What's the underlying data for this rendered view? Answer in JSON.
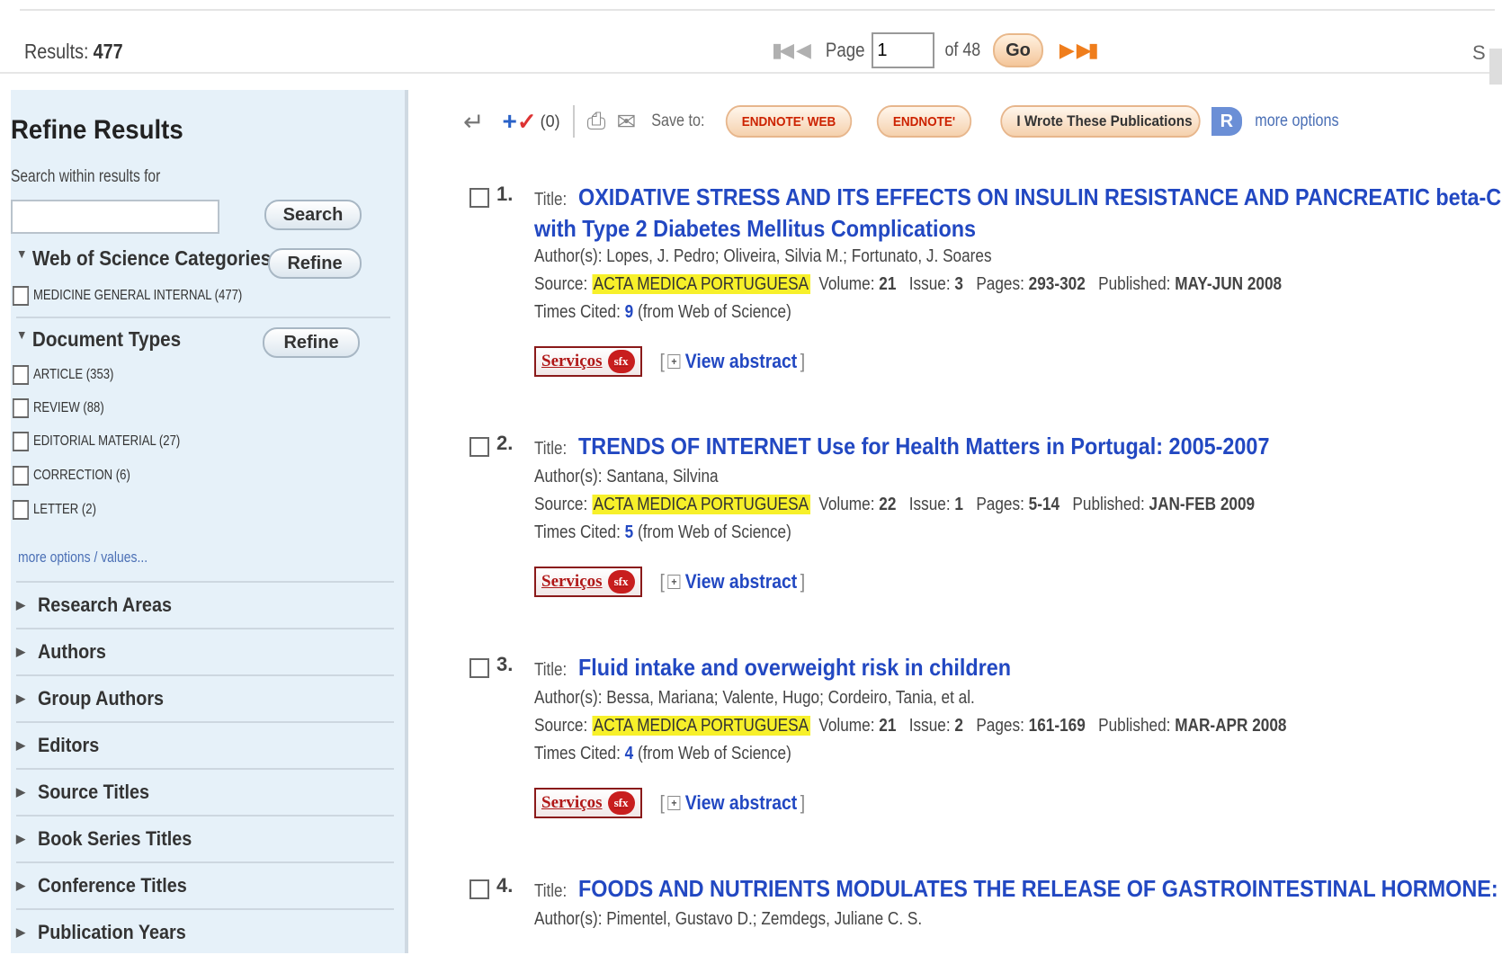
{
  "results": {
    "label": "Results:",
    "count": "477"
  },
  "pager": {
    "page_label": "Page",
    "page_value": "1",
    "of_label": "of 48",
    "go_label": "Go"
  },
  "sort_cut": "S",
  "sidebar": {
    "title": "Refine Results",
    "search_within_label": "Search within results for",
    "search_button": "Search",
    "wos_categories": {
      "title": "Web of Science Categories",
      "refine_label": "Refine",
      "items": [
        {
          "label": "MEDICINE GENERAL INTERNAL (477)"
        }
      ]
    },
    "document_types": {
      "title": "Document Types",
      "refine_label": "Refine",
      "items": [
        {
          "label": "ARTICLE (353)"
        },
        {
          "label": "REVIEW (88)"
        },
        {
          "label": "EDITORIAL MATERIAL (27)"
        },
        {
          "label": "CORRECTION (6)"
        },
        {
          "label": "LETTER (2)"
        }
      ],
      "more": "more options / values..."
    },
    "collapsed_facets": [
      "Research Areas",
      "Authors",
      "Group Authors",
      "Editors",
      "Source Titles",
      "Book Series Titles",
      "Conference Titles",
      "Publication Years"
    ]
  },
  "toolbar": {
    "marked_count": "(0)",
    "save_to_label": "Save to:",
    "endnote_web": "ENDNOTE' WEB",
    "endnote": "ENDNOTE'",
    "wrote_pubs": "I Wrote These Publications",
    "rid": "R",
    "more_options": "more options"
  },
  "labels": {
    "title": "Title:",
    "authors": "Author(s):",
    "source": "Source:",
    "volume": "Volume:",
    "issue": "Issue:",
    "pages": "Pages:",
    "published": "Published:",
    "times_cited": "Times Cited:",
    "from_wos": "(from Web of Science)",
    "services": "Serviços",
    "services_mark": "sfx",
    "view_abstract": "View abstract"
  },
  "records": [
    {
      "num": "1.",
      "title": "OXIDATIVE STRESS AND ITS EFFECTS ON INSULIN RESISTANCE AND PANCREATIC beta-C",
      "title_line2": "with Type 2 Diabetes Mellitus Complications",
      "authors": "Lopes, J. Pedro; Oliveira, Silvia M.; Fortunato, J. Soares",
      "source": "ACTA MEDICA PORTUGUESA",
      "volume": "21",
      "issue": "3",
      "pages": "293-302",
      "published": "MAY-JUN 2008",
      "times_cited": "9"
    },
    {
      "num": "2.",
      "title": "TRENDS OF INTERNET Use for Health Matters in Portugal: 2005-2007",
      "authors": "Santana, Silvina",
      "source": "ACTA MEDICA PORTUGUESA",
      "volume": "22",
      "issue": "1",
      "pages": "5-14",
      "published": "JAN-FEB 2009",
      "times_cited": "5"
    },
    {
      "num": "3.",
      "title": "Fluid intake and overweight risk in children",
      "authors": "Bessa, Mariana; Valente, Hugo; Cordeiro, Tania, et al.",
      "source": "ACTA MEDICA PORTUGUESA",
      "volume": "21",
      "issue": "2",
      "pages": "161-169",
      "published": "MAR-APR 2008",
      "times_cited": "4"
    },
    {
      "num": "4.",
      "title": "FOODS AND NUTRIENTS MODULATES THE RELEASE OF GASTROINTESTINAL HORMONE:",
      "authors": "Pimentel, Gustavo D.; Zemdegs, Juliane C. S."
    }
  ]
}
